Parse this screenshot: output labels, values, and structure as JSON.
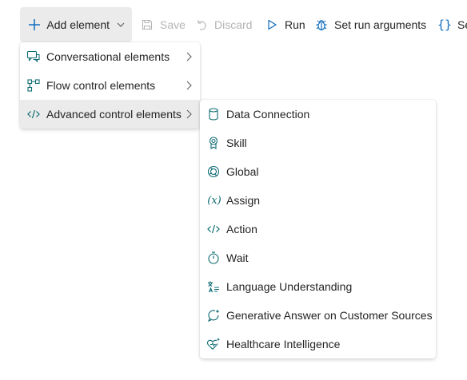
{
  "toolbar": {
    "add_element": "Add element",
    "save": "Save",
    "discard": "Discard",
    "run": "Run",
    "set_run_arguments": "Set run arguments",
    "truncated_item": "Se"
  },
  "menu": {
    "items": [
      {
        "label": "Conversational elements",
        "icon": "chat-bubbles-icon",
        "has_submenu": true
      },
      {
        "label": "Flow control elements",
        "icon": "flow-icon",
        "has_submenu": true
      },
      {
        "label": "Advanced control elements",
        "icon": "code-slash-icon",
        "has_submenu": true,
        "active": true
      }
    ]
  },
  "submenu": {
    "items": [
      {
        "label": "Data Connection",
        "icon": "database-icon"
      },
      {
        "label": "Skill",
        "icon": "ribbon-icon"
      },
      {
        "label": "Global",
        "icon": "globe-icon"
      },
      {
        "label": "Assign",
        "icon": "variable-icon"
      },
      {
        "label": "Action",
        "icon": "code-slash-icon"
      },
      {
        "label": "Wait",
        "icon": "timer-icon"
      },
      {
        "label": "Language Understanding",
        "icon": "translate-icon"
      },
      {
        "label": "Generative Answer on Customer Sources",
        "icon": "sparkle-chat-icon"
      },
      {
        "label": "Healthcare Intelligence",
        "icon": "heart-sparkle-icon"
      }
    ]
  },
  "colors": {
    "accent": "#0f6cbd",
    "icon_teal": "#0e6b73",
    "disabled": "#b4b4b4",
    "hover_bg": "#ebebeb"
  }
}
